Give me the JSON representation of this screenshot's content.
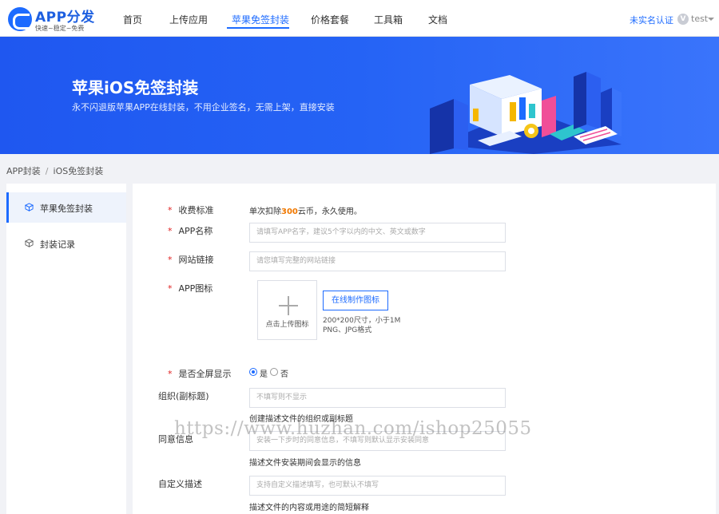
{
  "header": {
    "logo_title": "APP分发",
    "logo_subtitle": "快速~稳定~免费",
    "nav": [
      {
        "label": "首页"
      },
      {
        "label": "上传应用"
      },
      {
        "label": "苹果免签封装"
      },
      {
        "label": "价格套餐"
      },
      {
        "label": "工具箱"
      },
      {
        "label": "文档"
      }
    ],
    "active_nav": "苹果免签封装",
    "auth_link": "未实名认证",
    "user_initial": "V",
    "username": "test"
  },
  "banner": {
    "title": "苹果iOS免签封装",
    "subtitle": "永不闪退版苹果APP在线封装，不用企业签名，无需上架，直接安装"
  },
  "breadcrumb": {
    "root": "APP封装",
    "separator": "/",
    "current": "iOS免签封装"
  },
  "sidebar": {
    "items": [
      {
        "label": "苹果免签封装",
        "icon": "cube-icon",
        "active": true
      },
      {
        "label": "封装记录",
        "icon": "cube-icon",
        "active": false
      }
    ]
  },
  "form": {
    "fee": {
      "label": "收费标准",
      "prefix": "单次扣除",
      "amount": "300",
      "suffix": "云币，永久使用。"
    },
    "app_name": {
      "label": "APP名称",
      "placeholder": "请填写APP名字，建议5个字以内的中文、英文或数字"
    },
    "site_url": {
      "label": "网站链接",
      "placeholder": "请您填写完整的网站链接"
    },
    "app_icon": {
      "label": "APP图标",
      "upload_label": "点击上传图标",
      "make_button": "在线制作图标",
      "hint_size": "200*200尺寸，小于1M",
      "hint_format": "PNG、JPG格式"
    },
    "fullscreen": {
      "label": "是否全屏显示",
      "option_yes": "是",
      "option_no": "否",
      "selected": "是"
    },
    "organization": {
      "label": "组织(副标题)",
      "placeholder": "不填写则不显示",
      "helper": "创建描述文件的组织或副标题"
    },
    "consent": {
      "label": "同意信息",
      "placeholder": "安装一下步时的同意信息，不填写则默认显示安装同意",
      "helper": "描述文件安装期间会显示的信息"
    },
    "custom_desc": {
      "label": "自定义描述",
      "placeholder": "支持自定义描述填写，也可默认不填写",
      "helper": "描述文件的内容或用途的简短解释"
    }
  },
  "watermark": "https://www.huzhan.com/ishop25055",
  "colors": {
    "accent": "#1d6bff",
    "banner": "#2563f5",
    "required": "#e02020",
    "price": "#f07800"
  }
}
